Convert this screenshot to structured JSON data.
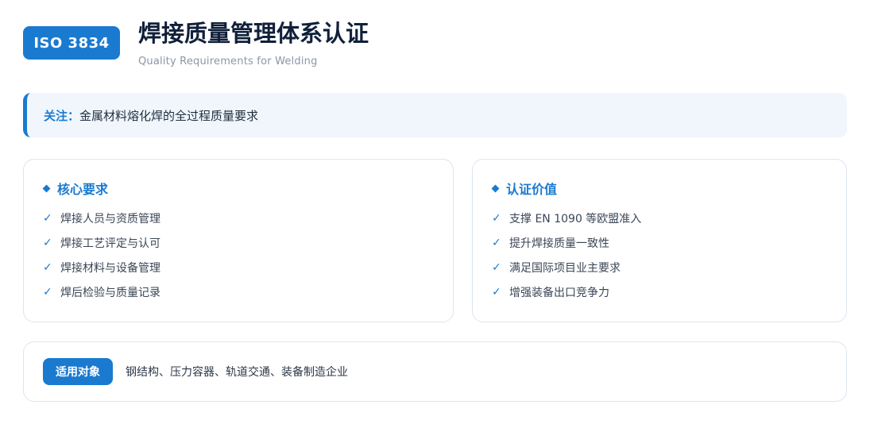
{
  "header": {
    "badge": "ISO 3834",
    "title": "焊接质量管理体系认证",
    "subtitle": "Quality Requirements for Welding"
  },
  "focus": {
    "label": "关注：",
    "text": "金属材料熔化焊的全过程质量要求"
  },
  "core": {
    "title": "核心要求",
    "items": [
      "焊接人员与资质管理",
      "焊接工艺评定与认可",
      "焊接材料与设备管理",
      "焊后检验与质量记录"
    ]
  },
  "value": {
    "title": "认证价值",
    "items": [
      "支撑 EN 1090 等欧盟准入",
      "提升焊接质量一致性",
      "满足国际项目业主要求",
      "增强装备出口竞争力"
    ]
  },
  "applicable": {
    "label": "适用对象",
    "text": "钢结构、压力容器、轨道交通、装备制造企业"
  },
  "icons": {
    "bullet": "diamond-icon",
    "check": "check-icon",
    "check_glyph": "✓"
  },
  "colors": {
    "accent": "#1a7ad0",
    "title": "#10203a",
    "subtitle": "#8a97a8",
    "focus_bg": "#f1f6fc",
    "border": "#dde5ef"
  }
}
